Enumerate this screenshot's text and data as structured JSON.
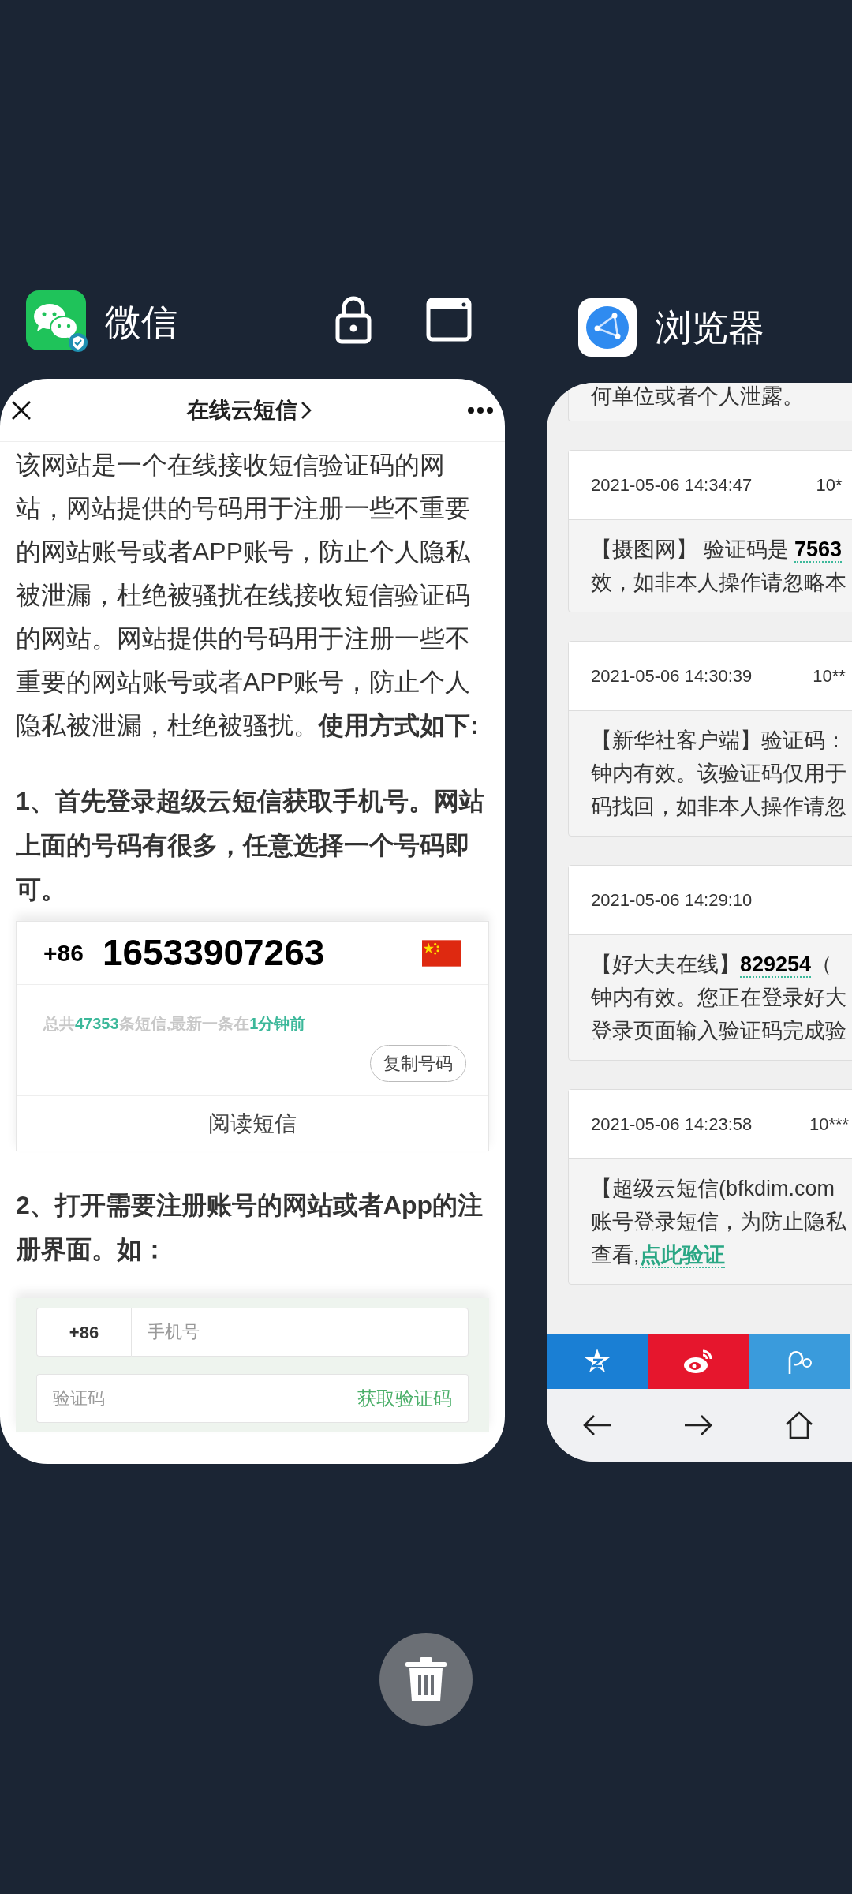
{
  "wechat": {
    "app_name": "微信",
    "page_title": "在线云短信",
    "content": [
      {
        "kind": "paragraph",
        "text": "该网站是一个在线接收短信验证码的网站，网站提供的号码用于注册一些不重要的网站账号或者APP账号，防止个人隐私被泄漏，杜绝被骚扰在线接收短信验证码的网站。网站提供的号码用于注册一些不重要的网站账号或者APP账号，防止个人隐私被泄漏，杜绝被骚扰。**使用方式如下:**"
      },
      {
        "kind": "heading",
        "text": "1、首先登录超级云短信获取手机号。网站上面的号码有很多，任意选择一个号码即可。"
      },
      {
        "kind": "number_card",
        "country_code": "+86",
        "number": "16533907263",
        "stats": [
          {
            "text": "总共",
            "kind": "plain"
          },
          {
            "text": "47353",
            "kind": "highlight"
          },
          {
            "text": "条短信,最新一条在",
            "kind": "plain"
          },
          {
            "text": "1分钟前",
            "kind": "highlight"
          }
        ],
        "copy_button": "复制号码",
        "read_button": "阅读短信"
      },
      {
        "kind": "heading",
        "text": "2、打开需要注册账号的网站或者App的注册界面。如："
      },
      {
        "kind": "form_card",
        "country_code": "+86",
        "phone_placeholder": "手机号",
        "code_placeholder": "验证码",
        "get_code": "获取验证码"
      }
    ]
  },
  "browser": {
    "app_name": "浏览器",
    "messages": [
      {
        "lines": [
          [
            {
              "text": "何单位或者个人泄露。",
              "kind": "plain"
            }
          ]
        ]
      },
      {
        "timestamp": "2021-05-06 14:34:47",
        "sender": "10*",
        "lines": [
          [
            {
              "text": "【摄图网】 验证码是 ",
              "kind": "plain"
            },
            {
              "text": "7563",
              "kind": "code"
            }
          ],
          [
            {
              "text": "效，如非本人操作请忽略本",
              "kind": "plain"
            }
          ]
        ]
      },
      {
        "timestamp": "2021-05-06 14:30:39",
        "sender": "10**",
        "lines": [
          [
            {
              "text": "【新华社客户端】验证码：",
              "kind": "plain"
            }
          ],
          [
            {
              "text": "钟内有效。该验证码仅用于",
              "kind": "plain"
            }
          ],
          [
            {
              "text": "码找回，如非本人操作请忽",
              "kind": "plain"
            }
          ]
        ]
      },
      {
        "timestamp": "2021-05-06 14:29:10",
        "lines": [
          [
            {
              "text": "【好大夫在线】",
              "kind": "plain"
            },
            {
              "text": "829254",
              "kind": "code"
            },
            {
              "text": "（",
              "kind": "plain"
            }
          ],
          [
            {
              "text": "钟内有效。您正在登录好大",
              "kind": "plain"
            }
          ],
          [
            {
              "text": "登录页面输入验证码完成验",
              "kind": "plain"
            }
          ]
        ]
      },
      {
        "timestamp": "2021-05-06 14:23:58",
        "sender": "10***",
        "lines": [
          [
            {
              "text": "【超级云短信(bfkdim.com",
              "kind": "plain"
            }
          ],
          [
            {
              "text": "账号登录短信，为防止隐私",
              "kind": "plain"
            }
          ],
          [
            {
              "text": "查看,",
              "kind": "plain"
            },
            {
              "text": "点此验证",
              "kind": "link"
            }
          ]
        ]
      }
    ],
    "share": [
      {
        "kind": "qzone",
        "color": "#1a7fd4"
      },
      {
        "kind": "weibo",
        "color": "#e6162d"
      },
      {
        "kind": "tweibo",
        "color": "#3a9bdc"
      }
    ],
    "nav": [
      {
        "kind": "back"
      },
      {
        "kind": "forward"
      },
      {
        "kind": "home"
      }
    ]
  }
}
